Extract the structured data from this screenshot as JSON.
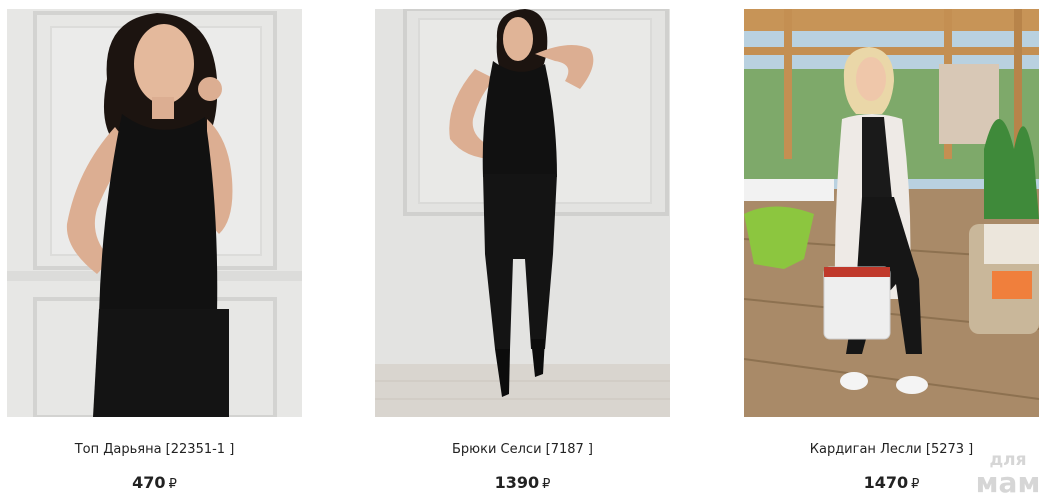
{
  "products": [
    {
      "title": "Топ Дарьяна [22351-1 ]",
      "price": "470",
      "currency": "₽",
      "image_alt": "photo"
    },
    {
      "title": "Брюки Селси [7187 ]",
      "price": "1390",
      "currency": "₽",
      "image_alt": "photo"
    },
    {
      "title": "Кардиган Лесли [5273 ]",
      "price": "1470",
      "currency": "₽",
      "image_alt": "photo"
    }
  ],
  "watermark": {
    "line1": "для",
    "line2": "мам"
  },
  "colors": {
    "text": "#222222",
    "watermark": "#d6d6d6",
    "garment": "#111111",
    "wall": "#e6e6e4"
  }
}
